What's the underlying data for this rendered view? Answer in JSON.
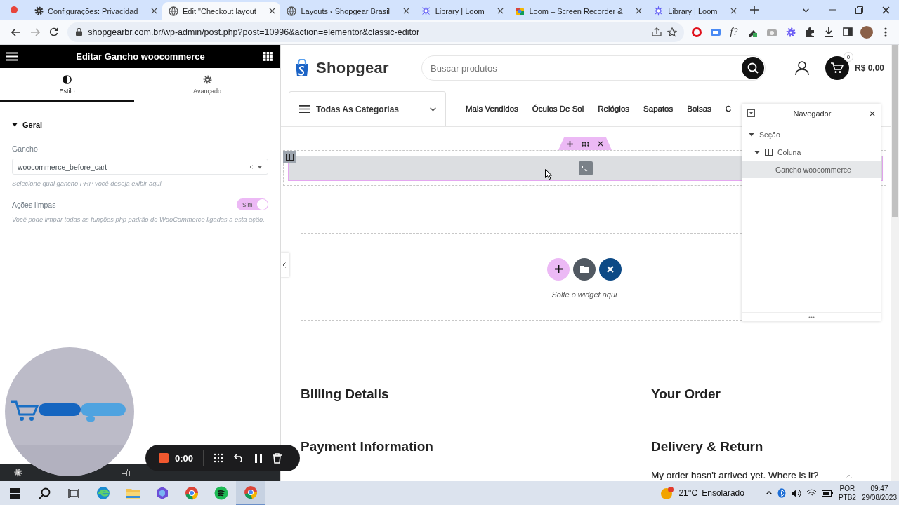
{
  "browser": {
    "tabs": [
      {
        "kind": "settings",
        "title": "Configurações: Privacidad",
        "selected": false
      },
      {
        "kind": "site",
        "title": "Edit \"Checkout layout",
        "selected": true
      },
      {
        "kind": "site",
        "title": "Layouts ‹ Shopgear Brasil",
        "selected": false
      },
      {
        "kind": "loom",
        "title": "Library | Loom",
        "selected": false
      },
      {
        "kind": "recorder",
        "title": "Loom – Screen Recorder &",
        "selected": false
      },
      {
        "kind": "loom",
        "title": "Library | Loom",
        "selected": false
      }
    ],
    "url": "shopgearbr.com.br/wp-admin/post.php?post=10996&action=elementor&classic-editor",
    "extension_text": "f?"
  },
  "editor_panel": {
    "title": "Editar Gancho woocommerce",
    "tabs": [
      {
        "kind": "style",
        "label": "Estilo",
        "selected": true
      },
      {
        "kind": "advanced",
        "label": "Avançado",
        "selected": false
      }
    ],
    "section": {
      "title": "Geral",
      "expanded": true
    },
    "controls": [
      {
        "kind": "select",
        "label": "Gancho",
        "value": "woocommerce_before_cart",
        "help": "Selecione qual gancho PHP você deseja exibir aqui."
      },
      {
        "kind": "switch",
        "label": "Ações limpas",
        "on": true,
        "state_label": "Sim",
        "help": "Você pode limpar todas as funções php padrão do WooCommerce ligadas a esta ação."
      }
    ]
  },
  "site": {
    "logo": "Shopgear",
    "search": {
      "placeholder": "Buscar produtos"
    },
    "cart_count": "0",
    "cart_total": "R$ 0,00",
    "categories": "Todas As Categorias",
    "menu": [
      "Mais Vendidos",
      "Óculos De Sol",
      "Relógios",
      "Sapatos",
      "Bolsas",
      "C"
    ],
    "drop_zone": "Solte o widget aqui",
    "headings": [
      "Billing Details",
      "Your Order",
      "Payment Information",
      "Delivery & Return"
    ],
    "faq": "My order hasn't arrived yet. Where is it?"
  },
  "navigator": {
    "title": "Navegador",
    "tree": [
      {
        "label": "Seção",
        "expanded": true,
        "selected": false,
        "children": [
          {
            "kind": "column",
            "label": "Coluna",
            "expanded": true,
            "selected": false,
            "children": [
              {
                "label": "Gancho woocommerce",
                "selected": true
              }
            ]
          }
        ]
      }
    ]
  },
  "recorder": {
    "time": "0:00"
  },
  "taskbar": {
    "apps": [
      {
        "kind": "edge",
        "selected": false
      },
      {
        "kind": "explorer",
        "selected": false
      },
      {
        "kind": "app",
        "selected": false
      },
      {
        "kind": "chrome",
        "selected": false
      },
      {
        "kind": "spotify",
        "selected": false
      },
      {
        "kind": "chrome",
        "selected": true
      }
    ],
    "temperature": "21°C",
    "condition": "Ensolarado",
    "language": "POR",
    "layout": "PTB2",
    "time": "09:47",
    "date": "29/08/2023"
  }
}
